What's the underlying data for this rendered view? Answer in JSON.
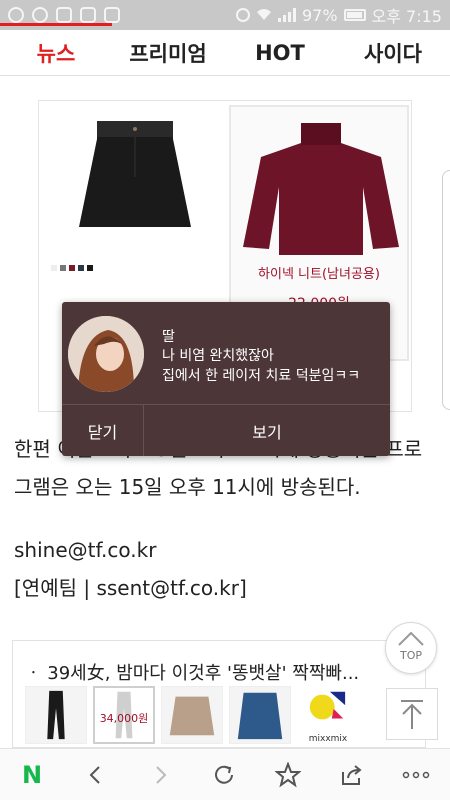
{
  "status_bar": {
    "battery": "97%",
    "time": "오후 7:15"
  },
  "tabs": [
    {
      "label": "뉴스"
    },
    {
      "label": "프리미엄"
    },
    {
      "label": "HOT"
    },
    {
      "label": "사이다"
    }
  ],
  "ad": {
    "product_title": "하이넥 니트(남녀공용)",
    "product_price": "22,000원"
  },
  "article": {
    "body": "한편 이날 오후 15일 오후 11시에 방송되는 프로그램은 오는 15일 오후 11시에 방송된다.",
    "email": "shine@tf.co.kr",
    "team": "[연예팀 | ssent@tf.co.kr]"
  },
  "related": {
    "headline": "ㆍ 39세女, 밤마다 이것후 '똥뱃살' 짝짝빠...",
    "thumb_price": "34,000원",
    "brand": "mixxmix"
  },
  "notification": {
    "sender": "딸",
    "line1": "나 비염 완치했잖아",
    "line2": "집에서 한 레이저 치료 덕분임ㅋㅋ",
    "close_label": "닫기",
    "view_label": "보기"
  },
  "floating": {
    "top_label": "TOP"
  },
  "colors": {
    "accent": "#e02020",
    "popup_bg": "#4d3638",
    "naver_green": "#14b84c"
  }
}
